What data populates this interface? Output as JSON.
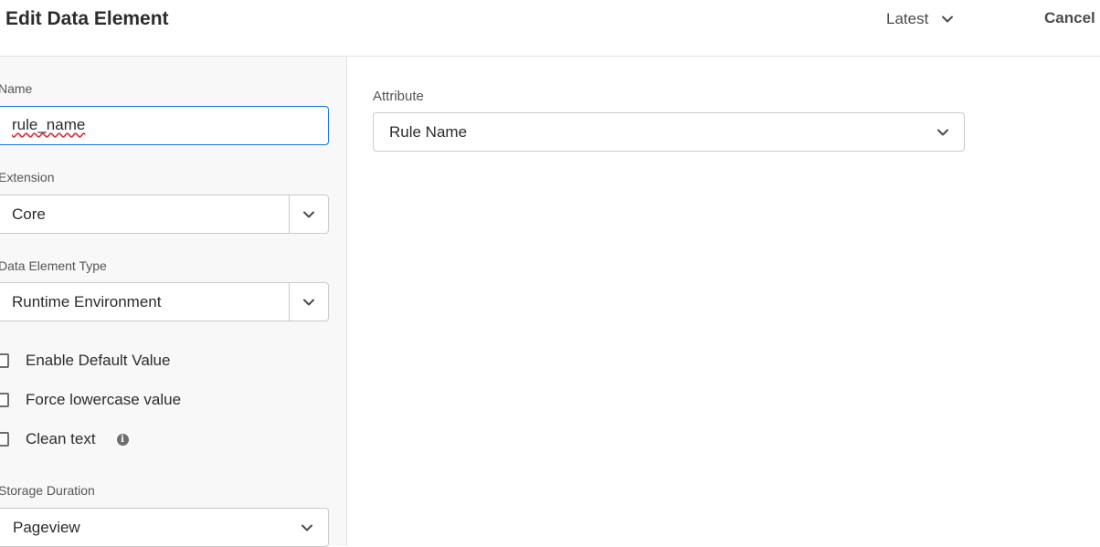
{
  "header": {
    "title": "Edit Data Element",
    "version_label": "Latest",
    "cancel_label": "Cancel"
  },
  "left_panel": {
    "name_field": {
      "label": "Name",
      "value": "rule_name"
    },
    "extension": {
      "label": "Extension",
      "value": "Core"
    },
    "data_element_type": {
      "label": "Data Element Type",
      "value": "Runtime Environment"
    },
    "checkboxes": [
      {
        "label": "Enable Default Value",
        "checked": false
      },
      {
        "label": "Force lowercase value",
        "checked": false
      },
      {
        "label": "Clean text",
        "checked": false
      }
    ],
    "storage_duration": {
      "label": "Storage Duration",
      "value": "Pageview"
    }
  },
  "right_panel": {
    "attribute": {
      "label": "Attribute",
      "value": "Rule Name"
    }
  },
  "icons": {
    "chevron": "chevron-down-icon",
    "info": "info-icon"
  },
  "colors": {
    "accent": "#1473e6",
    "spellcheck": "#d7373f",
    "panel_bg": "#f8f8f8"
  }
}
